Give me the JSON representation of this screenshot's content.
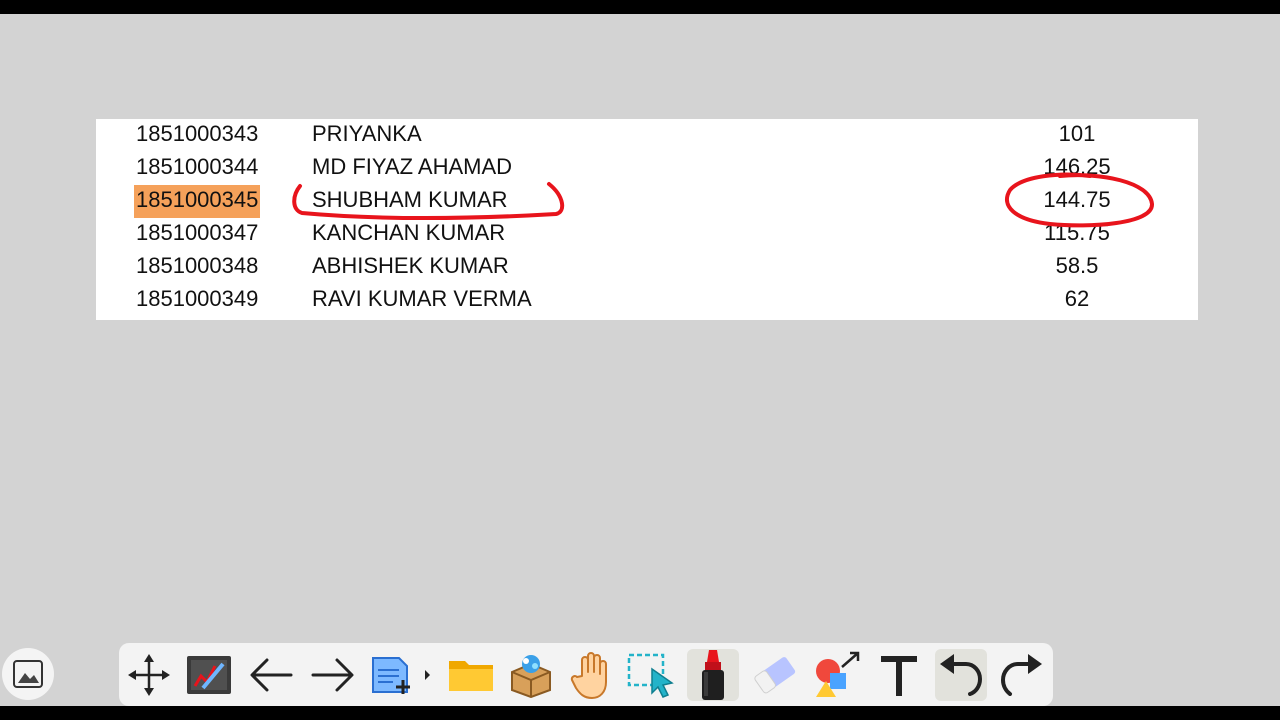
{
  "table": {
    "rows": [
      {
        "roll": "1851000343",
        "name": "PRIYANKA",
        "score": "101"
      },
      {
        "roll": "1851000344",
        "name": "MD FIYAZ AHAMAD",
        "score": "146.25"
      },
      {
        "roll": "1851000345",
        "name": "SHUBHAM KUMAR",
        "score": "144.75",
        "highlighted": true
      },
      {
        "roll": "1851000347",
        "name": "KANCHAN KUMAR",
        "score": "115.75"
      },
      {
        "roll": "1851000348",
        "name": "ABHISHEK KUMAR",
        "score": "58.5"
      },
      {
        "roll": "1851000349",
        "name": "RAVI KUMAR VERMA",
        "score": "62"
      }
    ],
    "highlight_color": "#f5a15a"
  },
  "annotations": {
    "ink_color": "#e8141c",
    "marks": [
      "underline-shubham-kumar",
      "circle-144-75"
    ]
  },
  "toolbar": {
    "tools": [
      "move-icon",
      "whiteboard-pen-icon",
      "arrow-left-icon",
      "arrow-right-icon",
      "new-page-icon",
      "folder-icon",
      "resource-box-icon",
      "hand-icon",
      "select-icon",
      "marker-icon",
      "eraser-icon",
      "shapes-icon",
      "text-icon",
      "undo-icon",
      "redo-icon"
    ],
    "active": [
      "marker-icon",
      "undo-icon"
    ]
  },
  "corner": {
    "icon": "image-gallery-icon"
  }
}
